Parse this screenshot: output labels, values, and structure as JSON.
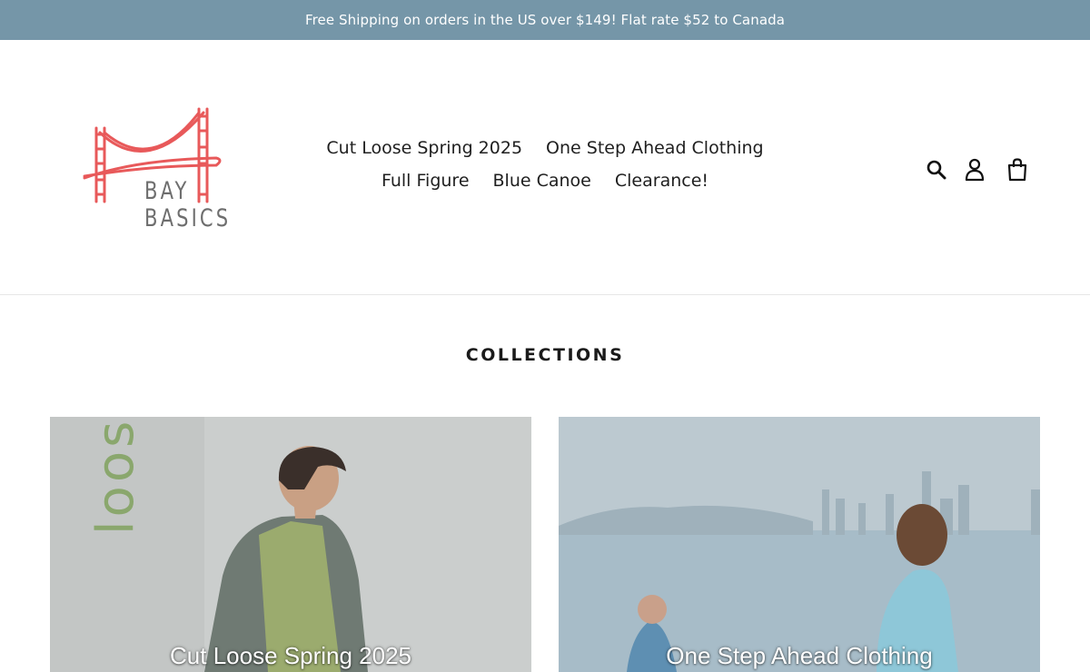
{
  "announcement": {
    "text": "Free Shipping on orders in the US over $149! Flat rate $52 to Canada"
  },
  "colors": {
    "announcement_bg": "#7596a8",
    "logo_red": "#e8595a",
    "logo_gray": "#6e6e6e"
  },
  "logo": {
    "line1": "BAY",
    "line2": "BASICS"
  },
  "nav": {
    "items": [
      {
        "label": "Cut Loose Spring 2025"
      },
      {
        "label": "One Step Ahead Clothing"
      },
      {
        "label": "Full Figure"
      },
      {
        "label": "Blue Canoe"
      },
      {
        "label": "Clearance!"
      }
    ]
  },
  "header_icons": [
    "search-icon",
    "account-icon",
    "cart-icon"
  ],
  "collections": {
    "title": "COLLECTIONS",
    "cards": [
      {
        "title": "Cut Loose Spring 2025",
        "image_text": "loose"
      },
      {
        "title": "One Step Ahead Clothing"
      }
    ]
  }
}
